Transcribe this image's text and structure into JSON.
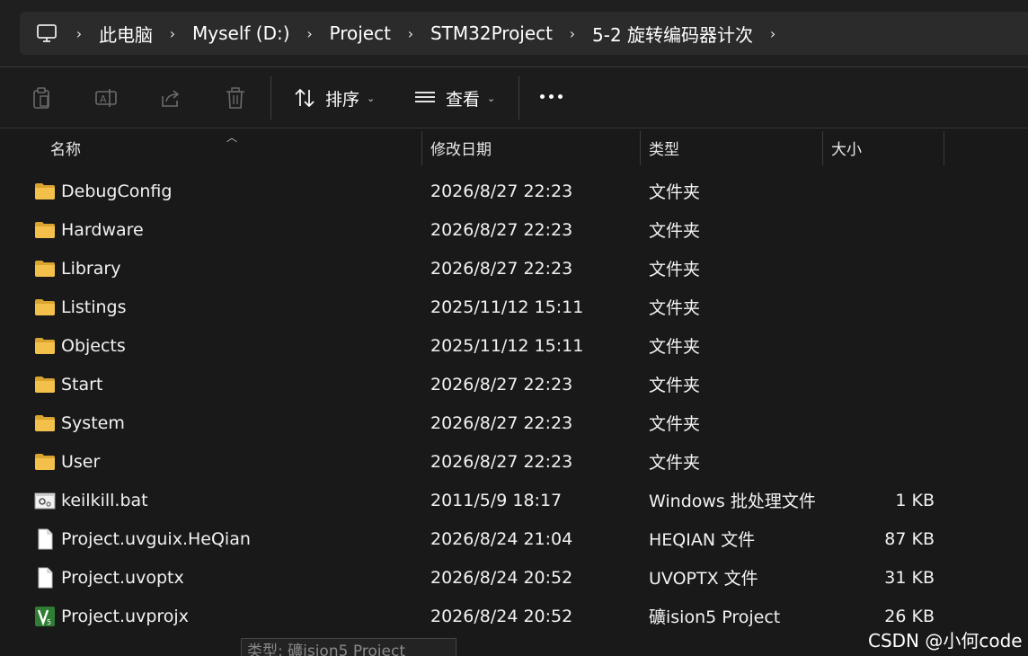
{
  "breadcrumb": {
    "icon": "computer-icon",
    "items": [
      "此电脑",
      "Myself (D:)",
      "Project",
      "STM32Project",
      "5-2 旋转编码器计次"
    ]
  },
  "toolbar": {
    "sort_label": "排序",
    "view_label": "查看"
  },
  "columns": {
    "name": "名称",
    "date": "修改日期",
    "type": "类型",
    "size": "大小"
  },
  "files": [
    {
      "name": "DebugConfig",
      "date": "2026/8/27 22:23",
      "type": "文件夹",
      "size": "",
      "icon": "folder-icon"
    },
    {
      "name": "Hardware",
      "date": "2026/8/27 22:23",
      "type": "文件夹",
      "size": "",
      "icon": "folder-icon"
    },
    {
      "name": "Library",
      "date": "2026/8/27 22:23",
      "type": "文件夹",
      "size": "",
      "icon": "folder-icon"
    },
    {
      "name": "Listings",
      "date": "2025/11/12 15:11",
      "type": "文件夹",
      "size": "",
      "icon": "folder-icon"
    },
    {
      "name": "Objects",
      "date": "2025/11/12 15:11",
      "type": "文件夹",
      "size": "",
      "icon": "folder-icon"
    },
    {
      "name": "Start",
      "date": "2026/8/27 22:23",
      "type": "文件夹",
      "size": "",
      "icon": "folder-icon"
    },
    {
      "name": "System",
      "date": "2026/8/27 22:23",
      "type": "文件夹",
      "size": "",
      "icon": "folder-icon"
    },
    {
      "name": "User",
      "date": "2026/8/27 22:23",
      "type": "文件夹",
      "size": "",
      "icon": "folder-icon"
    },
    {
      "name": "keilkill.bat",
      "date": "2011/5/9 18:17",
      "type": "Windows 批处理文件",
      "size": "1 KB",
      "icon": "batch-file-icon"
    },
    {
      "name": "Project.uvguix.HeQian",
      "date": "2026/8/24 21:04",
      "type": "HEQIAN 文件",
      "size": "87 KB",
      "icon": "blank-file-icon"
    },
    {
      "name": "Project.uvoptx",
      "date": "2026/8/24 20:52",
      "type": "UVOPTX 文件",
      "size": "31 KB",
      "icon": "blank-file-icon"
    },
    {
      "name": "Project.uvprojx",
      "date": "2026/8/24 20:52",
      "type": "礦ision5 Project",
      "size": "26 KB",
      "icon": "keil-project-icon"
    }
  ],
  "tooltip": "类型: 礦ision5 Project",
  "watermark": "CSDN @小何code",
  "colors": {
    "folder": "#f3c14b",
    "folder_dark": "#d9a42f",
    "background": "#191919",
    "keil_green": "#2e7d32"
  }
}
